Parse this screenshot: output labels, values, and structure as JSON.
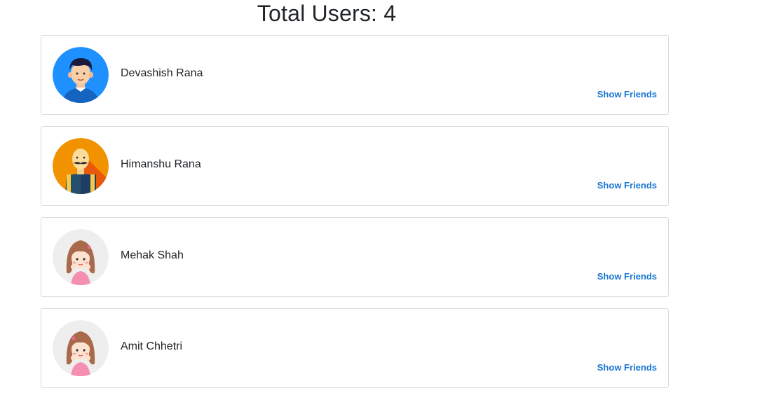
{
  "header": {
    "title": "Total Users: 4"
  },
  "users": [
    {
      "name": "Devashish Rana",
      "avatar": "boy-avatar-icon",
      "action_label": "Show Friends"
    },
    {
      "name": "Himanshu Rana",
      "avatar": "mustache-man-avatar-icon",
      "action_label": "Show Friends"
    },
    {
      "name": "Mehak Shah",
      "avatar": "girl-avatar-icon",
      "action_label": "Show Friends"
    },
    {
      "name": "Amit Chhetri",
      "avatar": "girl-avatar-icon",
      "action_label": "Show Friends"
    }
  ],
  "colors": {
    "link": "#1976d2",
    "card_border": "#dcdcdc",
    "avatar_blue": "#1e90ff",
    "avatar_orange": "#f39200",
    "avatar_grey": "#eeeeee"
  }
}
